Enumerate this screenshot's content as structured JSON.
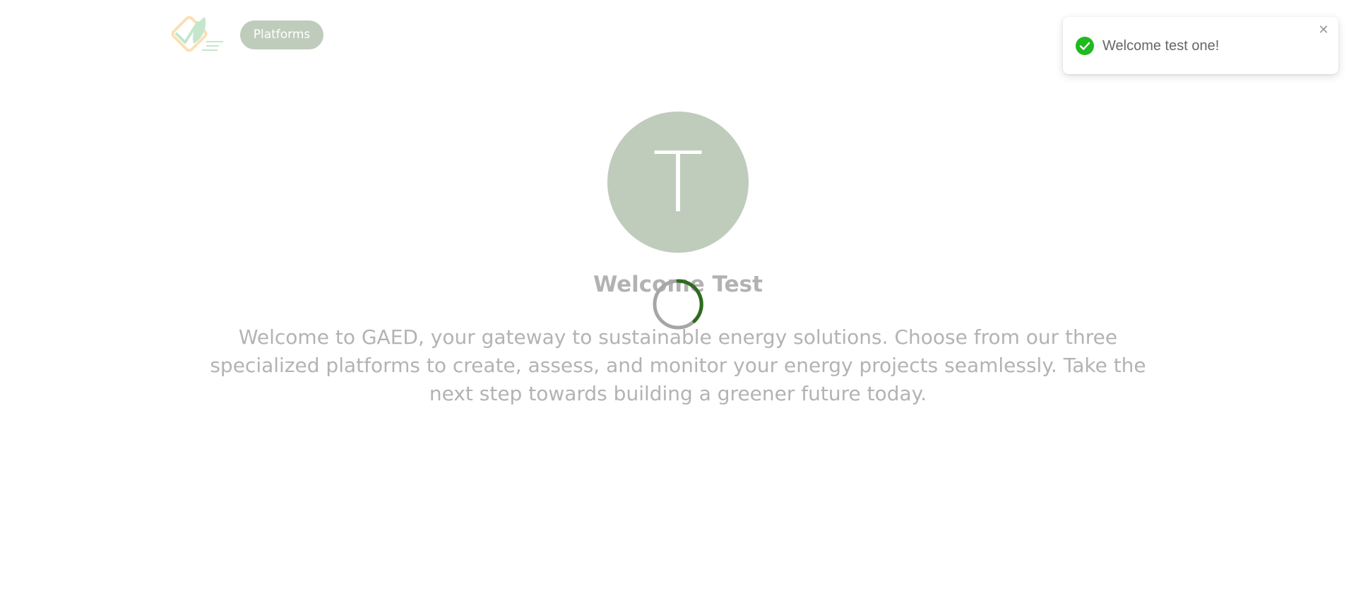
{
  "header": {
    "logo_icon": "gaed-leaf-check-logo",
    "platforms_label": "Platforms"
  },
  "profile": {
    "avatar_initial": "T",
    "welcome_title": "Welcome Test",
    "intro_text": "Welcome to GAED, your gateway to sustainable energy solutions. Choose from our three specialized platforms to create, assess, and monitor your energy projects seamlessly. Take the next step towards building a greener future today."
  },
  "loading": {
    "icon": "loading-spinner-icon"
  },
  "toast": {
    "icon": "success-check-icon",
    "message": "Welcome test one!",
    "close_icon": "close-icon"
  },
  "colors": {
    "brand_sage": "#bfccbc",
    "spinner_accent": "#2e6b1f",
    "success_green": "#1fba1f",
    "logo_orange": "#f5c36b",
    "logo_green": "#8ccf9a"
  }
}
